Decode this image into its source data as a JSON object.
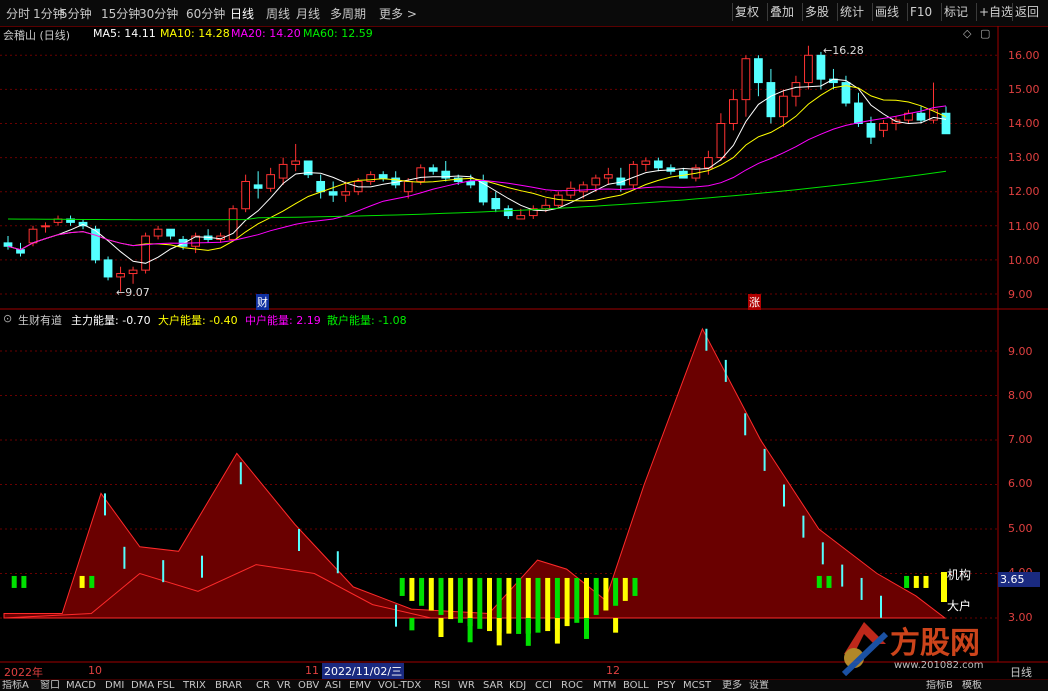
{
  "toolbar": {
    "periods": [
      "分时",
      "1分钟",
      "5分钟",
      "15分钟",
      "30分钟",
      "60分钟",
      "日线",
      "周线",
      "月线",
      "多周期",
      "更多 >"
    ],
    "active": "日线",
    "right_buttons": [
      "复权",
      "叠加",
      "多股",
      "统计",
      "画线",
      "F10",
      "标记",
      "+自选",
      "返回"
    ]
  },
  "main_chart": {
    "stock_label": "会稽山 (日线)",
    "ma": [
      {
        "name": "MA5:",
        "value": "14.11",
        "color": "#ffffff"
      },
      {
        "name": "MA10:",
        "value": "14.28",
        "color": "#ffff00"
      },
      {
        "name": "MA20:",
        "value": "14.20",
        "color": "#ff00ff"
      },
      {
        "name": "MA60:",
        "value": "12.59",
        "color": "#00e000"
      }
    ],
    "y_ticks": [
      "16.00",
      "15.00",
      "14.00",
      "13.00",
      "12.00",
      "11.00",
      "10.00",
      "9.00"
    ],
    "high_marker": "16.28",
    "low_marker": "9.07",
    "badge_cai": "财",
    "badge_zhang": "涨"
  },
  "indicator": {
    "name": "生财有道",
    "items": [
      {
        "label": "主力能量:",
        "value": "-0.70",
        "color": "#ffffff"
      },
      {
        "label": "大户能量:",
        "value": "-0.40",
        "color": "#ffff00"
      },
      {
        "label": "中户能量:",
        "value": "2.19",
        "color": "#ff00ff"
      },
      {
        "label": "散户能量:",
        "value": "-1.08",
        "color": "#00e000"
      }
    ],
    "y_ticks": [
      "9.00",
      "8.00",
      "7.00",
      "6.00",
      "5.00",
      "4.00",
      "3.00"
    ],
    "current_value": "3.65",
    "label_jigou": "机构",
    "label_dahu": "大户"
  },
  "date_axis": {
    "year": "2022年",
    "months": [
      "10",
      "11",
      "12"
    ],
    "cursor_date": "2022/11/02/三",
    "period_label": "日线"
  },
  "bottom_tabs": [
    "指标A",
    "窗口",
    "MACD",
    "DMI",
    "DMA",
    "FSL",
    "TRIX",
    "BRAR",
    "CR",
    "VR",
    "OBV",
    "ASI",
    "EMV",
    "VOL-TDX",
    "RSI",
    "WR",
    "SAR",
    "KDJ",
    "CCI",
    "ROC",
    "MTM",
    "BOLL",
    "PSY",
    "MCST",
    "更多",
    "设置"
  ],
  "bottom_right": [
    "指标B",
    "模板"
  ],
  "watermark": {
    "brand": "方股网",
    "url": "www.201082.com"
  },
  "colors": {
    "up": "#ff3232",
    "down": "#54ffff",
    "grid": "#800000",
    "ma5": "#ffffff",
    "ma10": "#ffff00",
    "ma20": "#ff00ff",
    "ma60": "#00e000"
  }
}
